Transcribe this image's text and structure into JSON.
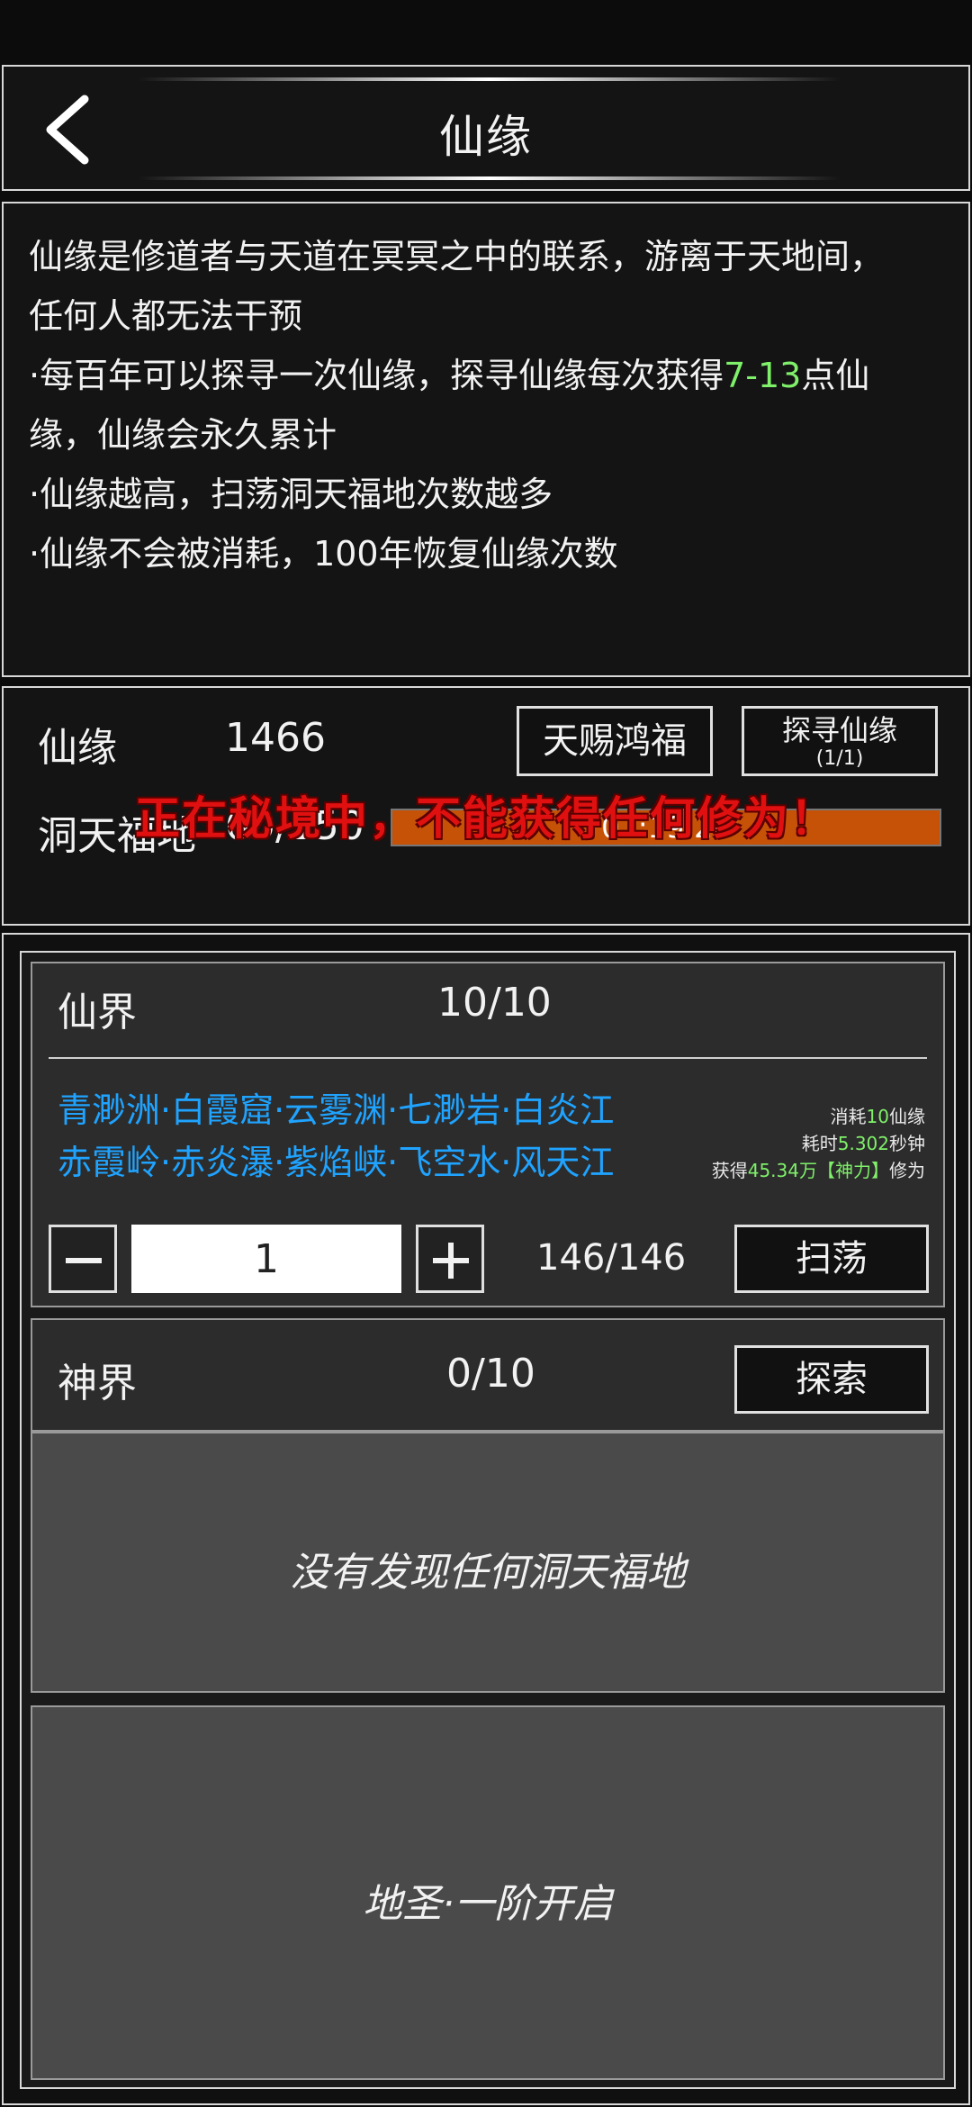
{
  "header": {
    "title": "仙缘",
    "back_icon": "chevron-left-icon"
  },
  "description": {
    "line1": "仙缘是修道者与天道在冥冥之中的联系，游离于天地间，",
    "line2": "任何人都无法干预",
    "line3_pre": "·每百年可以探寻一次仙缘，探寻仙缘每次获得",
    "line3_highlight": "7-13",
    "line3_post": "点仙",
    "line4": "缘，仙缘会永久累计",
    "line5": "·仙缘越高，扫荡洞天福地次数越多",
    "line6": "·仙缘不会被消耗，100年恢复仙缘次数"
  },
  "stats": {
    "xianyuan_label": "仙缘",
    "xianyuan_value": "1466",
    "blessing_button": "天赐鸿福",
    "seek_button": "探寻仙缘",
    "seek_count": "(1/1)",
    "dongtian_label": "洞天福地",
    "dongtian_value": "60/150",
    "timer": "01:19:24",
    "warning": "正在秘境中，不能获得任何修为！"
  },
  "xianjie": {
    "title": "仙界",
    "count": "10/10",
    "locations_row1": "青渺洲·白霞窟·云雾渊·七渺岩·白炎江",
    "locations_row2": "赤霞岭·赤炎瀑·紫焰峡·飞空水·风天江",
    "cost_pre": "消耗",
    "cost_value": "10",
    "cost_post": "仙缘",
    "time_pre": "耗时",
    "time_value": "5.302",
    "time_post": "秒钟",
    "gain_pre": "获得",
    "gain_value": "45.34万【神力】",
    "gain_post": "修为",
    "quantity": "1",
    "remaining": "146/146",
    "sweep_button": "扫荡"
  },
  "shenjie": {
    "title": "神界",
    "count": "0/10",
    "explore_button": "探索",
    "empty_message": "没有发现任何洞天福地",
    "unlock_message": "地圣·一阶开启"
  },
  "colors": {
    "highlight_green": "#7ff06a",
    "location_blue": "#1fa3ff",
    "warning_red": "#e01010",
    "progress_orange": "#c65208"
  }
}
